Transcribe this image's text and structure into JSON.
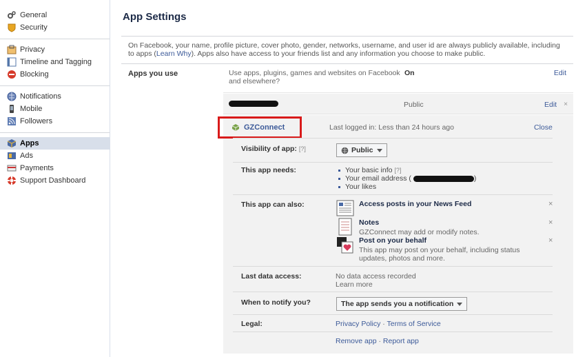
{
  "sidebar": {
    "groups": [
      [
        {
          "label": "General",
          "icon": "gear-icon"
        },
        {
          "label": "Security",
          "icon": "badge-icon"
        }
      ],
      [
        {
          "label": "Privacy",
          "icon": "privacy-icon"
        },
        {
          "label": "Timeline and Tagging",
          "icon": "timeline-icon"
        },
        {
          "label": "Blocking",
          "icon": "block-icon"
        }
      ],
      [
        {
          "label": "Notifications",
          "icon": "globe-icon"
        },
        {
          "label": "Mobile",
          "icon": "phone-icon"
        },
        {
          "label": "Followers",
          "icon": "rss-icon"
        }
      ],
      [
        {
          "label": "Apps",
          "icon": "cube-icon"
        },
        {
          "label": "Ads",
          "icon": "ads-icon"
        },
        {
          "label": "Payments",
          "icon": "card-icon"
        },
        {
          "label": "Support Dashboard",
          "icon": "lifebuoy-icon"
        }
      ]
    ]
  },
  "page": {
    "title": "App Settings",
    "intro_text": "On Facebook, your name, profile picture, cover photo, gender, networks, username, and user id are always publicly available, including to apps (",
    "intro_link": "Learn Why",
    "intro_text2": "). Apps also have access to your friends list and any information you choose to make public."
  },
  "apps_you_use": {
    "label": "Apps you use",
    "description": "Use apps, plugins, games and websites on Facebook and elsewhere?",
    "status": "On",
    "edit": "Edit"
  },
  "other_app": {
    "visibility": "Public",
    "edit": "Edit",
    "remove": "×"
  },
  "app": {
    "name": "GZConnect",
    "last_logged": "Last logged in: Less than 24 hours ago",
    "close": "Close",
    "visibility_label": "Visibility of app:",
    "help_mark": "[?]",
    "visibility_value": "Public",
    "needs_label": "This app needs:",
    "needs": [
      "Your basic info",
      "Your email address",
      "Your likes"
    ],
    "email_paren_open": "(",
    "email_paren_close": ")",
    "can_also_label": "This app can also:",
    "permissions": [
      {
        "title": "Access posts in your News Feed",
        "desc": "",
        "remove": "×"
      },
      {
        "title": "Notes",
        "desc": "GZConnect may add or modify notes.",
        "remove": "×"
      },
      {
        "title": "Post on your behalf",
        "desc": "This app may post on your behalf, including status updates, photos and more.",
        "remove": "×"
      }
    ],
    "last_access_label": "Last data access:",
    "last_access_value": "No data access recorded",
    "learn_more": "Learn more",
    "notify_label": "When to notify you?",
    "notify_value": "The app sends you a notification",
    "legal_label": "Legal:",
    "privacy_policy": "Privacy Policy",
    "terms": "Terms of Service",
    "sep": "·",
    "remove_app": "Remove app",
    "report_app": "Report app"
  },
  "colors": {
    "link": "#3b5998",
    "highlight": "#d91a1a",
    "panel": "#f2f2f2"
  }
}
